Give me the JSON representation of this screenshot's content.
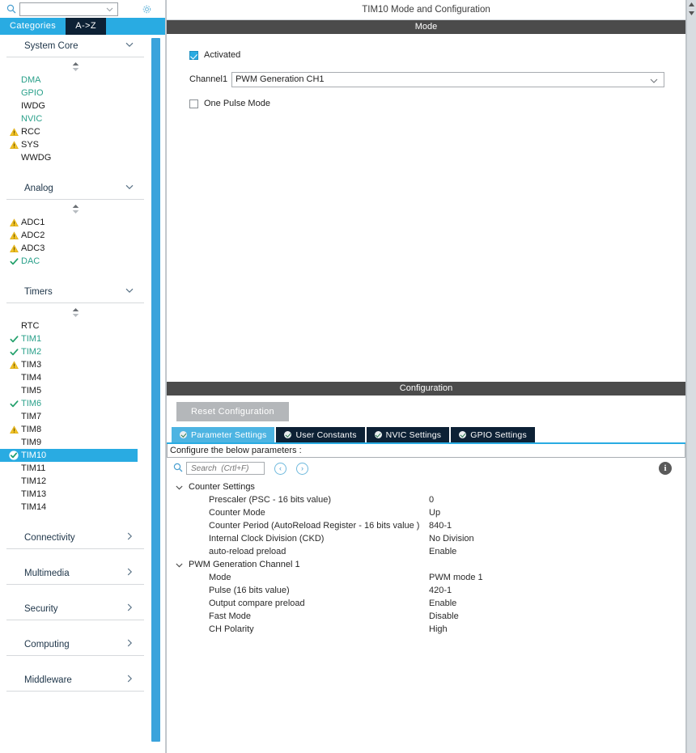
{
  "left": {
    "search": {
      "value": "",
      "placeholder": "",
      "icon": "search-icon"
    },
    "settings_icon": "gear-icon",
    "tabs": [
      {
        "label": "Categories",
        "active": true
      },
      {
        "label": "A->Z",
        "active": false
      }
    ],
    "groups": [
      {
        "name": "System Core",
        "expanded": true,
        "items": [
          {
            "label": "DMA",
            "state": "configured",
            "badge": "none"
          },
          {
            "label": "GPIO",
            "state": "configured",
            "badge": "none"
          },
          {
            "label": "IWDG",
            "state": "none",
            "badge": "none"
          },
          {
            "label": "NVIC",
            "state": "configured",
            "badge": "none"
          },
          {
            "label": "RCC",
            "state": "warning",
            "badge": "warning-icon"
          },
          {
            "label": "SYS",
            "state": "warning",
            "badge": "warning-icon"
          },
          {
            "label": "WWDG",
            "state": "none",
            "badge": "none"
          }
        ]
      },
      {
        "name": "Analog",
        "expanded": true,
        "items": [
          {
            "label": "ADC1",
            "state": "none",
            "badge": "warning-icon"
          },
          {
            "label": "ADC2",
            "state": "none",
            "badge": "warning-icon"
          },
          {
            "label": "ADC3",
            "state": "none",
            "badge": "warning-icon"
          },
          {
            "label": "DAC",
            "state": "configured",
            "badge": "check-icon"
          }
        ]
      },
      {
        "name": "Timers",
        "expanded": true,
        "items": [
          {
            "label": "RTC",
            "state": "none",
            "badge": "none"
          },
          {
            "label": "TIM1",
            "state": "configured",
            "badge": "check-icon"
          },
          {
            "label": "TIM2",
            "state": "configured",
            "badge": "check-icon"
          },
          {
            "label": "TIM3",
            "state": "none",
            "badge": "warning-icon"
          },
          {
            "label": "TIM4",
            "state": "none",
            "badge": "none"
          },
          {
            "label": "TIM5",
            "state": "none",
            "badge": "none"
          },
          {
            "label": "TIM6",
            "state": "configured",
            "badge": "check-icon"
          },
          {
            "label": "TIM7",
            "state": "none",
            "badge": "none"
          },
          {
            "label": "TIM8",
            "state": "none",
            "badge": "warning-icon"
          },
          {
            "label": "TIM9",
            "state": "none",
            "badge": "none"
          },
          {
            "label": "TIM10",
            "state": "selected",
            "badge": "check-icon"
          },
          {
            "label": "TIM11",
            "state": "none",
            "badge": "none"
          },
          {
            "label": "TIM12",
            "state": "none",
            "badge": "none"
          },
          {
            "label": "TIM13",
            "state": "none",
            "badge": "none"
          },
          {
            "label": "TIM14",
            "state": "none",
            "badge": "none"
          }
        ]
      }
    ],
    "collapsed_groups": [
      {
        "name": "Connectivity"
      },
      {
        "name": "Multimedia"
      },
      {
        "name": "Security"
      },
      {
        "name": "Computing"
      },
      {
        "name": "Middleware"
      }
    ]
  },
  "right": {
    "page_title": "TIM10 Mode and Configuration",
    "mode": {
      "section_title": "Mode",
      "activated": {
        "label": "Activated",
        "checked": true
      },
      "channel": {
        "label": "Channel1",
        "value": "PWM Generation CH1"
      },
      "one_pulse": {
        "label": "One Pulse Mode",
        "checked": false
      }
    },
    "configuration": {
      "section_title": "Configuration",
      "reset_button": "Reset Configuration",
      "tabs": [
        {
          "label": "Parameter Settings",
          "active": true
        },
        {
          "label": "User Constants",
          "active": false
        },
        {
          "label": "NVIC Settings",
          "active": false
        },
        {
          "label": "GPIO Settings",
          "active": false
        }
      ],
      "hint": "Configure the below parameters :",
      "search": {
        "value": "",
        "placeholder": "Search  (Crtl+F)"
      },
      "nav_prev": "‹",
      "nav_next": "›",
      "info_icon": "info-icon",
      "groups": [
        {
          "name": "Counter Settings",
          "expanded": true,
          "rows": [
            {
              "key": "Prescaler (PSC - 16 bits value)",
              "value": "0"
            },
            {
              "key": "Counter Mode",
              "value": "Up"
            },
            {
              "key": "Counter Period (AutoReload Register - 16 bits value )",
              "value": "840-1"
            },
            {
              "key": "Internal Clock Division (CKD)",
              "value": "No Division"
            },
            {
              "key": "auto-reload preload",
              "value": "Enable"
            }
          ]
        },
        {
          "name": "PWM Generation Channel 1",
          "expanded": true,
          "rows": [
            {
              "key": "Mode",
              "value": "PWM mode 1"
            },
            {
              "key": "Pulse (16 bits value)",
              "value": "420-1"
            },
            {
              "key": "Output compare preload",
              "value": "Enable"
            },
            {
              "key": "Fast Mode",
              "value": "Disable"
            },
            {
              "key": "CH Polarity",
              "value": "High"
            }
          ]
        }
      ]
    }
  },
  "colors": {
    "accent_blue": "#29abe2",
    "tab_dark": "#0d2135",
    "section_bar": "#4b4b4b",
    "configured_green": "#2aa08a",
    "warning_yellow": "#f2c225",
    "check_green": "#22a06b",
    "reset_gray": "#b4b7ba"
  }
}
